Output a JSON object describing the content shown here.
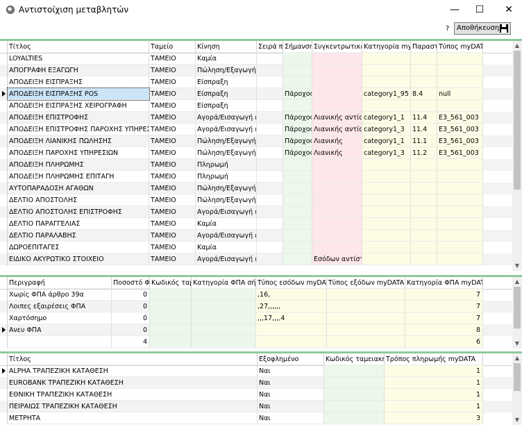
{
  "window": {
    "title": "Αντιστοίχιση μεταβλητών",
    "minimize": "—",
    "maximize": "☐",
    "close": "✕"
  },
  "toolbar": {
    "help": "?",
    "save_label": "Αποθήκευση"
  },
  "grid1": {
    "columns": [
      "Τίτλος",
      "Ταμείο",
      "Κίνηση",
      "Σειρά π",
      "Σήμανση",
      "Συγκεντρωτικές",
      "Κατηγορία myDA",
      "Παραστ",
      "Τύπος myDATA"
    ],
    "rows": [
      [
        "LOYALTIES",
        "ΤΑΜΕΙΟ",
        "Καμία",
        "",
        "",
        "",
        "",
        "",
        ""
      ],
      [
        "ΑΠΟΓΡΑΦΗ ΕΞΑΓΩΓΗ",
        "ΤΑΜΕΙΟ",
        "Πώληση/Εξαγωγή ε",
        "",
        "",
        "",
        "",
        "",
        ""
      ],
      [
        "ΑΠΟΔΕΙΞΗ ΕΙΣΠΡΑΞΗΣ",
        "ΤΑΜΕΙΟ",
        "Είσπραξη",
        "",
        "",
        "",
        "",
        "",
        ""
      ],
      [
        "ΑΠΟΔΕΙΞΗ ΕΙΣΠΡΑΞΗΣ POS",
        "ΤΑΜΕΙΟ",
        "Είσπραξη",
        "",
        "Πάροχος",
        "",
        "category1_95",
        "8.4",
        "null"
      ],
      [
        "ΑΠΟΔΕΙΞΗ ΕΙΣΠΡΑΞΗΣ ΧΕΙΡΟΓΡΑΦΗ",
        "ΤΑΜΕΙΟ",
        "Είσπραξη",
        "",
        "",
        "",
        "",
        "",
        ""
      ],
      [
        "ΑΠΟΔΕΙΞΗ ΕΠΙΣΤΡΟΦΗΣ",
        "ΤΑΜΕΙΟ",
        "Αγορά/Εισαγωγή εμ",
        "",
        "Πάροχος",
        "Λιανικής αντίστρ",
        "category1_1",
        "11.4",
        "E3_561_003"
      ],
      [
        "ΑΠΟΔΕΙΞΗ ΕΠΙΣΤΡΟΦΗΣ ΠΑΡΟΧΗΣ ΥΠΗΡΕΣΙ",
        "ΤΑΜΕΙΟ",
        "Αγορά/Εισαγωγή εμ",
        "",
        "Πάροχος",
        "Λιανικής αντίστρ",
        "category1_3",
        "11.4",
        "E3_561_003"
      ],
      [
        "ΑΠΟΔΕΙΞΗ ΛΙΑΝΙΚΗΣ ΠΩΛΗΣΗΣ",
        "ΤΑΜΕΙΟ",
        "Πώληση/Εξαγωγή ε",
        "",
        "Πάροχος",
        "Λιανικής",
        "category1_1",
        "11.1",
        "E3_561_003"
      ],
      [
        "ΑΠΟΔΕΙΞΗ ΠΑΡΟΧΗΣ ΥΠΗΡΕΣΙΩΝ",
        "ΤΑΜΕΙΟ",
        "Πώληση/Εξαγωγή ε",
        "",
        "Πάροχος",
        "Λιανικής",
        "category1_3",
        "11.2",
        "E3_561_003"
      ],
      [
        "ΑΠΟΔΕΙΞΗ ΠΛΗΡΩΜΗΣ",
        "ΤΑΜΕΙΟ",
        "Πληρωμή",
        "",
        "",
        "",
        "",
        "",
        ""
      ],
      [
        "ΑΠΟΔΕΙΞΗ ΠΛΗΡΩΜΗΣ ΕΠΙΤΑΓΗ",
        "ΤΑΜΕΙΟ",
        "Πληρωμή",
        "",
        "",
        "",
        "",
        "",
        ""
      ],
      [
        "ΑΥΤΟΠΑΡΑΔΟΣΗ ΑΓΑΘΩΝ",
        "ΤΑΜΕΙΟ",
        "Πώληση/Εξαγωγή ε",
        "",
        "",
        "",
        "",
        "",
        ""
      ],
      [
        "ΔΕΛΤΙΟ ΑΠΟΣΤΟΛΗΣ",
        "ΤΑΜΕΙΟ",
        "Πώληση/Εξαγωγή ε",
        "",
        "",
        "",
        "",
        "",
        ""
      ],
      [
        "ΔΕΛΤΙΟ ΑΠΟΣΤΟΛΗΣ ΕΠΙΣΤΡΟΦΗΣ",
        "ΤΑΜΕΙΟ",
        "Αγορά/Εισαγωγή εμ",
        "",
        "",
        "",
        "",
        "",
        ""
      ],
      [
        "ΔΕΛΤΙΟ ΠΑΡΑΓΓΕΛΙΑΣ",
        "ΤΑΜΕΙΟ",
        "Καμία",
        "",
        "",
        "",
        "",
        "",
        ""
      ],
      [
        "ΔΕΛΤΙΟ ΠΑΡΑΛΑΒΗΣ",
        "ΤΑΜΕΙΟ",
        "Αγορά/Εισαγωγή εμ",
        "",
        "",
        "",
        "",
        "",
        ""
      ],
      [
        "ΔΩΡΟΕΠΙΤΑΓΕΣ",
        "ΤΑΜΕΙΟ",
        "Καμία",
        "",
        "",
        "",
        "",
        "",
        ""
      ],
      [
        "ΕΙΔΙΚΟ ΑΚΥΡΩΤΙΚΟ ΣΤΟΙΧΕΙΟ",
        "ΤΑΜΕΙΟ",
        "Αγορά/Εισαγωγή εμ",
        "",
        "",
        "Εσόδων αντίστρ",
        "",
        "",
        ""
      ]
    ]
  },
  "grid2": {
    "columns": [
      "Περιγραφή",
      "Ποσοστό Φ",
      "Κωδικός ταμει",
      "Κατηγορία ΦΠΑ σήμ",
      "Τύπος εσόδων myDAT",
      "Τύπος εξόδων myDATA",
      "Κατηγορία ΦΠΑ myDATA"
    ],
    "rows": [
      [
        "Χωρίς ΦΠΑ άρθρο 39α",
        "0",
        "",
        "",
        ",16,",
        "",
        "7"
      ],
      [
        "Λοιπες εξαιρέσεις ΦΠΑ",
        "0",
        "",
        "",
        ",27,,,,,,",
        "",
        "7"
      ],
      [
        "Χαρτόσημο",
        "0",
        "",
        "",
        ",,,17,,,,4",
        "",
        "7"
      ],
      [
        "Ανευ ΦΠΑ",
        "0",
        "",
        "",
        "",
        "",
        "8"
      ],
      [
        "",
        "4",
        "",
        "",
        "",
        "",
        "6"
      ]
    ]
  },
  "grid3": {
    "columns": [
      "Τίτλος",
      "Εξοφλημένο",
      "Κωδικός ταμειακής",
      "Τρόπος πληρωμής myDATA"
    ],
    "rows": [
      [
        "ALPHA ΤΡΑΠΕΖΙΚΗ ΚΑΤΑΘΕΣΗ",
        "Ναι",
        "",
        "1"
      ],
      [
        "EUROBANK ΤΡΑΠΕΖΙΚΗ ΚΑΤΑΘΕΣΗ",
        "Ναι",
        "",
        "1"
      ],
      [
        "ΕΘΝΙΚΗ ΤΡΑΠΕΖΙΚΗ ΚΑΤΑΘΕΣΗ",
        "Ναι",
        "",
        "1"
      ],
      [
        "ΠΕΙΡΑΙΩΣ ΤΡΑΠΕΖΙΚΗ ΚΑΤΑΘΕΣΗ",
        "Ναι",
        "",
        "1"
      ],
      [
        "ΜΕΤΡΗΤΑ",
        "Ναι",
        "",
        "3"
      ]
    ]
  },
  "scroll_arrows": {
    "up": "▲",
    "down": "▼"
  }
}
